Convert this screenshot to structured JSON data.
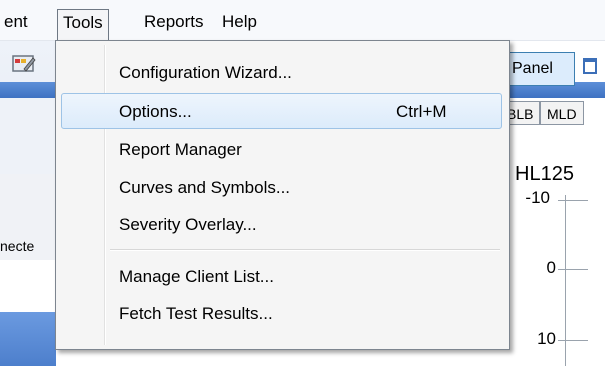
{
  "menubar": {
    "items": [
      {
        "label": "ent"
      },
      {
        "label": "Tools"
      },
      {
        "label": "Reports"
      },
      {
        "label": "Help"
      }
    ]
  },
  "background": {
    "panel_button_label": "l Panel",
    "tabs": [
      "BLB",
      "MLD"
    ],
    "side_text": "necte",
    "chart_title": "HL125",
    "ticks": [
      "-10",
      "0",
      "10"
    ]
  },
  "tools_menu": {
    "items": [
      {
        "label": "Configuration Wizard...",
        "shortcut": ""
      },
      {
        "label": "Options...",
        "shortcut": "Ctrl+M",
        "highlighted": true
      },
      {
        "label": "Report Manager",
        "shortcut": ""
      },
      {
        "label": "Curves and Symbols...",
        "shortcut": ""
      },
      {
        "label": "Severity Overlay...",
        "shortcut": ""
      },
      {
        "label": "Manage Client List...",
        "shortcut": ""
      },
      {
        "label": "Fetch Test Results...",
        "shortcut": ""
      }
    ]
  },
  "colors": {
    "highlight_border": "#9ec3e6",
    "accent_blue": "#3e72c2"
  }
}
